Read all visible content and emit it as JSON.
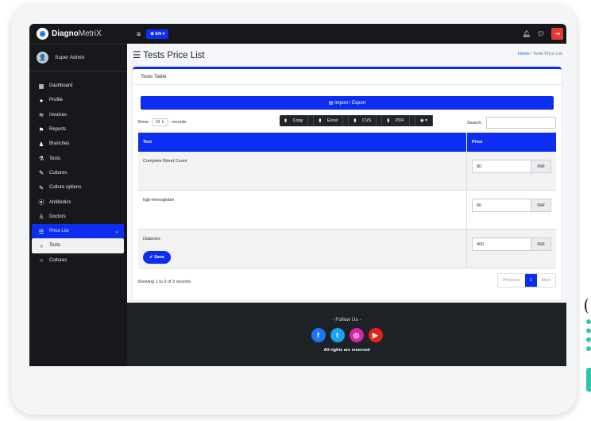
{
  "brand": {
    "name_bold": "Diagno",
    "name_rest": "MetriX"
  },
  "user": {
    "name": "Super Admin"
  },
  "sidebar": {
    "items": [
      {
        "label": "Dashboard",
        "icon": "grid-icon"
      },
      {
        "label": "Profile",
        "icon": "user-icon"
      },
      {
        "label": "Invoices",
        "icon": "layers-icon"
      },
      {
        "label": "Reports",
        "icon": "flag-icon"
      },
      {
        "label": "Branches",
        "icon": "users-icon"
      },
      {
        "label": "Tests",
        "icon": "flask-icon"
      },
      {
        "label": "Cultures",
        "icon": "pen-icon"
      },
      {
        "label": "Culture options",
        "icon": "pen-icon"
      },
      {
        "label": "Antibiotics",
        "icon": "capsule-icon"
      },
      {
        "label": "Doctors",
        "icon": "doctor-icon"
      },
      {
        "label": "Price List",
        "icon": "list-icon"
      },
      {
        "label": "Tests",
        "icon": "circle-icon"
      },
      {
        "label": "Cultures",
        "icon": "circle-icon"
      }
    ]
  },
  "topbar": {
    "lang": "EN"
  },
  "page": {
    "title": "Tests Price List"
  },
  "breadcrumb": {
    "home": "Home",
    "sep": "/",
    "current": "Tests Price List"
  },
  "card": {
    "title": "Tests Table",
    "import_label": "Import / Export"
  },
  "controls": {
    "show_label": "Show",
    "records_value": "10",
    "records_label": "records",
    "search_label": "Search:",
    "exports": [
      "Copy",
      "Excel",
      "CVS",
      "PDF",
      "◉ ▾"
    ]
  },
  "table": {
    "headers": {
      "test": "Test",
      "price": "Price"
    },
    "rows": [
      {
        "test": "Complete Blood Count",
        "price": "80",
        "unit": "INR"
      },
      {
        "test": "hgb-hemoglobin",
        "price": "80",
        "unit": "INR"
      },
      {
        "test": "Diabetes",
        "price": "400",
        "unit": "INR"
      }
    ]
  },
  "save_label": "Save",
  "showing_text": "Showing 1 to 3 of 3 records",
  "pager": {
    "prev": "Previous",
    "current": "1",
    "next": "Next"
  },
  "footer": {
    "follow": "- Follow Us -",
    "rights": "All rights are reserved"
  },
  "colors": {
    "accent": "#0d2df0",
    "sidebar_bg": "#16181b",
    "footer_bg": "#1e2226"
  }
}
